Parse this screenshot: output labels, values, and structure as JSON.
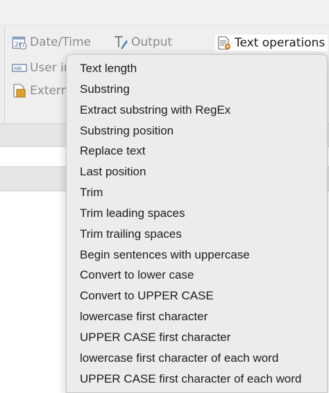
{
  "toolbar": {
    "tools": [
      {
        "label": "Date/Time",
        "icon": "calendar-clock-icon"
      },
      {
        "label": "Output",
        "icon": "output-pen-icon"
      },
      {
        "label": "Text operations",
        "icon": "text-document-gear-icon",
        "active": true
      },
      {
        "label": "User in",
        "icon": "abc-input-icon"
      },
      {
        "label": "Externa",
        "icon": "external-document-icon"
      }
    ]
  },
  "menu": {
    "items": [
      "Text length",
      "Substring",
      "Extract substring with RegEx",
      "Substring position",
      "Replace text",
      "Last position",
      "Trim",
      "Trim leading spaces",
      "Trim trailing spaces",
      "Begin sentences with uppercase",
      "Convert to lower case",
      "Convert to UPPER CASE",
      "lowercase  first character",
      "UPPER CASE first character",
      "lowercase  first character of each word",
      "UPPER CASE first character of each word"
    ]
  },
  "colors": {
    "menu_bg": "#ececec",
    "menu_text": "#1c1c1c",
    "icon_blue": "#4a7fc0",
    "disabled_text": "#8a8a8a"
  }
}
